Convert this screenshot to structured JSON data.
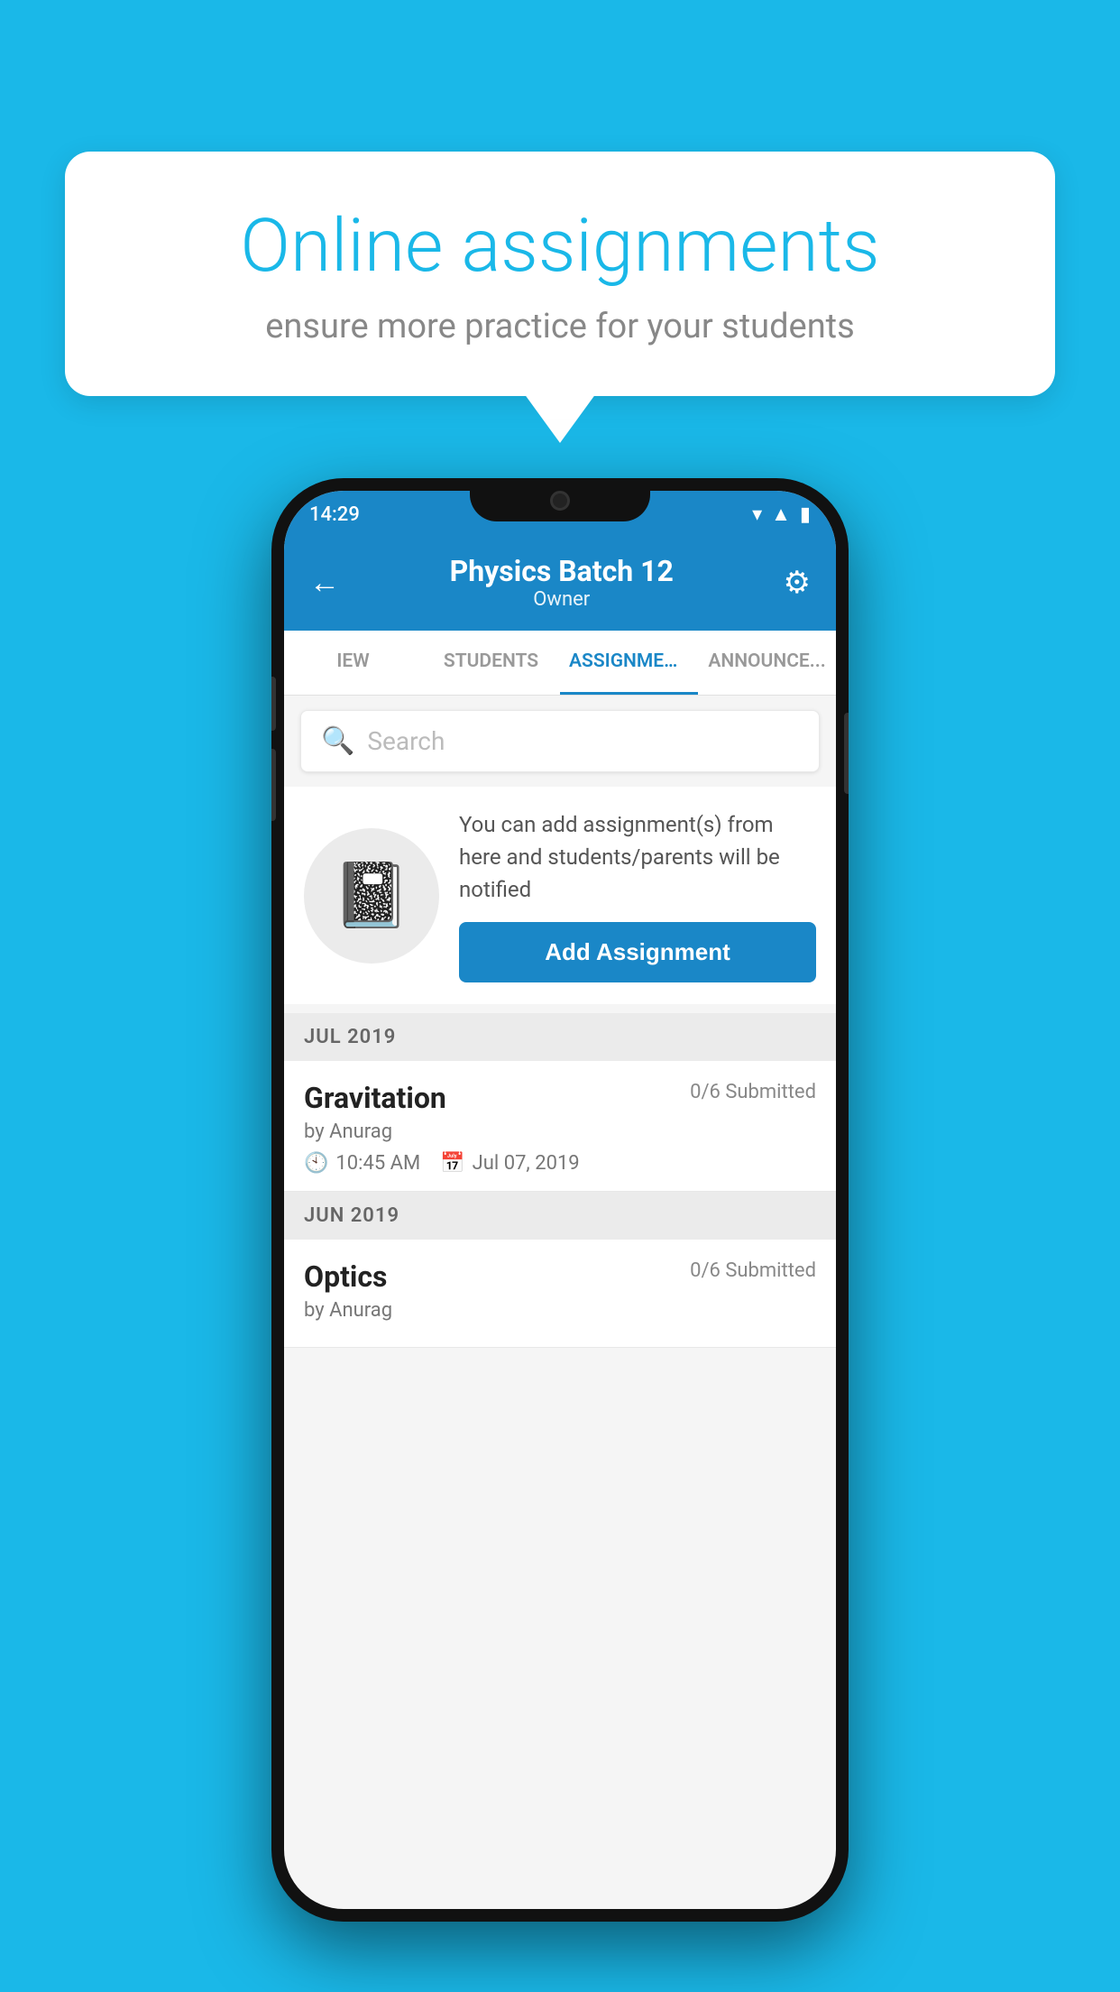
{
  "background_color": "#1ab8e8",
  "speech_bubble": {
    "title": "Online assignments",
    "subtitle": "ensure more practice for your students"
  },
  "status_bar": {
    "time": "14:29",
    "icons": [
      "wifi",
      "signal",
      "battery"
    ]
  },
  "app_header": {
    "title": "Physics Batch 12",
    "subtitle": "Owner",
    "back_label": "←",
    "settings_label": "⚙"
  },
  "tabs": [
    {
      "label": "IEW",
      "active": false
    },
    {
      "label": "STUDENTS",
      "active": false
    },
    {
      "label": "ASSIGNMENTS",
      "active": true
    },
    {
      "label": "ANNOUNCEMENTS",
      "active": false
    }
  ],
  "search": {
    "placeholder": "Search"
  },
  "empty_state": {
    "icon": "📓",
    "text": "You can add assignment(s) from here and students/parents will be notified",
    "button_label": "Add Assignment"
  },
  "sections": [
    {
      "month": "JUL 2019",
      "assignments": [
        {
          "name": "Gravitation",
          "submitted": "0/6 Submitted",
          "by": "by Anurag",
          "time": "10:45 AM",
          "date": "Jul 07, 2019"
        }
      ]
    },
    {
      "month": "JUN 2019",
      "assignments": [
        {
          "name": "Optics",
          "submitted": "0/6 Submitted",
          "by": "by Anurag",
          "time": "",
          "date": ""
        }
      ]
    }
  ]
}
